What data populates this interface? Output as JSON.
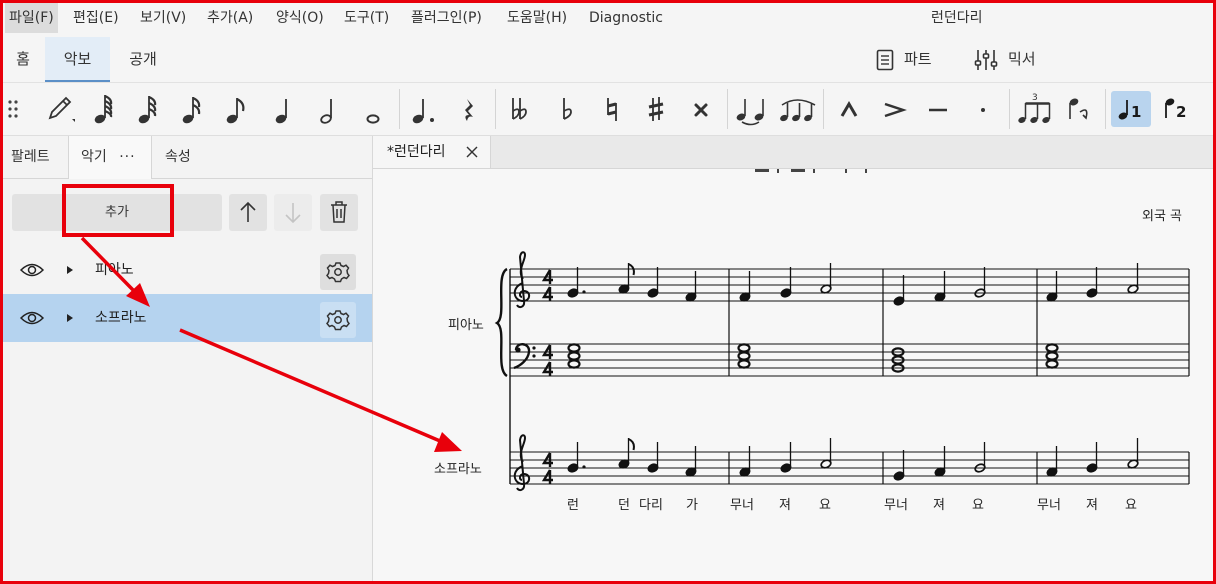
{
  "menu": {
    "items": [
      "파일(F)",
      "편집(E)",
      "보기(V)",
      "추가(A)",
      "양식(O)",
      "도구(T)",
      "플러그인(P)",
      "도움말(H)",
      "Diagnostic"
    ],
    "window_title": "런던다리"
  },
  "tabs": {
    "main": [
      "홈",
      "악보",
      "공개"
    ],
    "parts_label": "파트",
    "mixer_label": "믹서"
  },
  "toolbar": {
    "tools": [
      "drag-handle",
      "note-input-pencil",
      "64th-note",
      "32nd-note",
      "16th-note",
      "8th-note",
      "quarter-note",
      "half-note",
      "whole-note",
      "augmentation-dot",
      "rest",
      "double-flat",
      "flat",
      "natural",
      "sharp",
      "double-sharp",
      "tie",
      "slur",
      "marcato",
      "accent",
      "tenuto",
      "staccato",
      "tuplet",
      "flip-direction",
      "voice-1",
      "voice-2"
    ],
    "voice1_label": "1",
    "voice2_label": "2"
  },
  "panel": {
    "tabs": [
      "팔레트",
      "악기",
      "속성"
    ],
    "more_label": "···",
    "add_button": "추가",
    "instruments": [
      {
        "name": "피아노",
        "selected": false
      },
      {
        "name": "소프라노",
        "selected": true
      }
    ]
  },
  "document": {
    "tab_title": "*런던다리",
    "composer": "외국 곡",
    "staff_piano": "피아노",
    "staff_soprano": "소프라노",
    "time_signature": "4/4",
    "lyrics": [
      "런",
      "던",
      "다리",
      "가",
      "무너",
      "져",
      "요",
      "무너",
      "져",
      "요",
      "무너",
      "져",
      "요"
    ]
  },
  "colors": {
    "annotation": "#e8000b",
    "selected_row": "#b5d3ef",
    "active_tab_underline": "#5b8fc7"
  }
}
